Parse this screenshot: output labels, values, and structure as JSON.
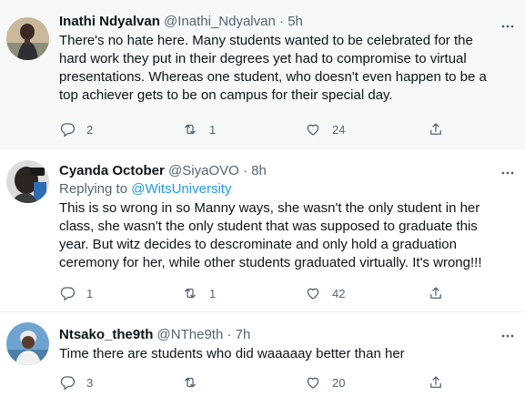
{
  "tweets": [
    {
      "name": "Inathi Ndyalvan",
      "handle": "@Inathi_Ndyalvan",
      "time": "5h",
      "replying_prefix": "",
      "replying_to": "",
      "text": "There's no hate here. Many students wanted to be celebrated for the hard work they put in their degrees yet had to compromise to virtual presentations.  Whereas one student, who doesn't even happen to be a top achiever gets to be on campus for their special day.",
      "replies": "2",
      "retweets": "1",
      "likes": "24"
    },
    {
      "name": "Cyanda October",
      "handle": "@SiyaOVO",
      "time": "8h",
      "replying_prefix": "Replying to",
      "replying_to": "@WitsUniversity",
      "text": "This is so wrong in so Manny ways, she wasn't the only student in her class, she wasn't the only student that was supposed to graduate this year. But witz decides to descrominate and only hold a graduation ceremony for her, while other students graduated virtually. It's wrong!!!",
      "replies": "1",
      "retweets": "1",
      "likes": "42"
    },
    {
      "name": "Ntsako_the9th",
      "handle": "@NThe9th",
      "time": "7h",
      "replying_prefix": "",
      "replying_to": "",
      "text": "Time there are students who did waaaaay better than her",
      "replies": "3",
      "retweets": "",
      "likes": "20"
    }
  ],
  "separator": "·",
  "colors": {
    "accent": "#1d9bf0",
    "secondary_text": "#536471",
    "highlight_bg": "#f7f9f9"
  }
}
